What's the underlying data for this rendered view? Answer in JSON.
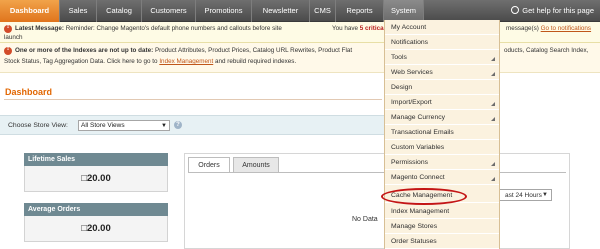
{
  "nav": {
    "items": [
      "Dashboard",
      "Sales",
      "Catalog",
      "Customers",
      "Promotions",
      "Newsletter",
      "CMS",
      "Reports",
      "System"
    ],
    "help": "Get help for this page"
  },
  "messages": {
    "latest_label": "Latest Message:",
    "latest_text": "Reminder: Change Magento's default phone numbers and callouts before site",
    "latest_text_2": "launch",
    "critical_prefix": "You have",
    "critical_count": "5 critical",
    "critical_suffix": ",",
    "other_tail": "message(s)",
    "goto_notifications": "Go to notifications",
    "index_label": "One or more of the Indexes are not up to date:",
    "index_text": "Product Attributes, Product Prices, Catalog URL Rewrites, Product Flat",
    "index_text_tail": "oducts, Catalog Search Index,",
    "index_text_2": "Stock Status, Tag Aggregation Data. Click here to go to",
    "index_link": "Index Management",
    "index_text_3": "and rebuild required indexes."
  },
  "dashboard": {
    "title": "Dashboard",
    "store_label": "Choose Store View:",
    "store_value": "All Store Views",
    "lifetime_sales_label": "Lifetime Sales",
    "lifetime_sales_value": "□20.00",
    "average_orders_label": "Average Orders",
    "average_orders_value": "□20.00",
    "tabs": [
      "Orders",
      "Amounts"
    ],
    "period_value": "ast 24 Hours",
    "no_data": "No Data"
  },
  "system_menu": {
    "items": [
      "My Account",
      "Notifications",
      "Tools",
      "Web Services",
      "Design",
      "Import/Export",
      "Manage Currency",
      "Transactional Emails",
      "Custom Variables",
      "Permissions",
      "Magento Connect",
      "Cache Management",
      "Index Management",
      "Manage Stores",
      "Order Statuses"
    ],
    "highlighted": "Cache Management"
  }
}
